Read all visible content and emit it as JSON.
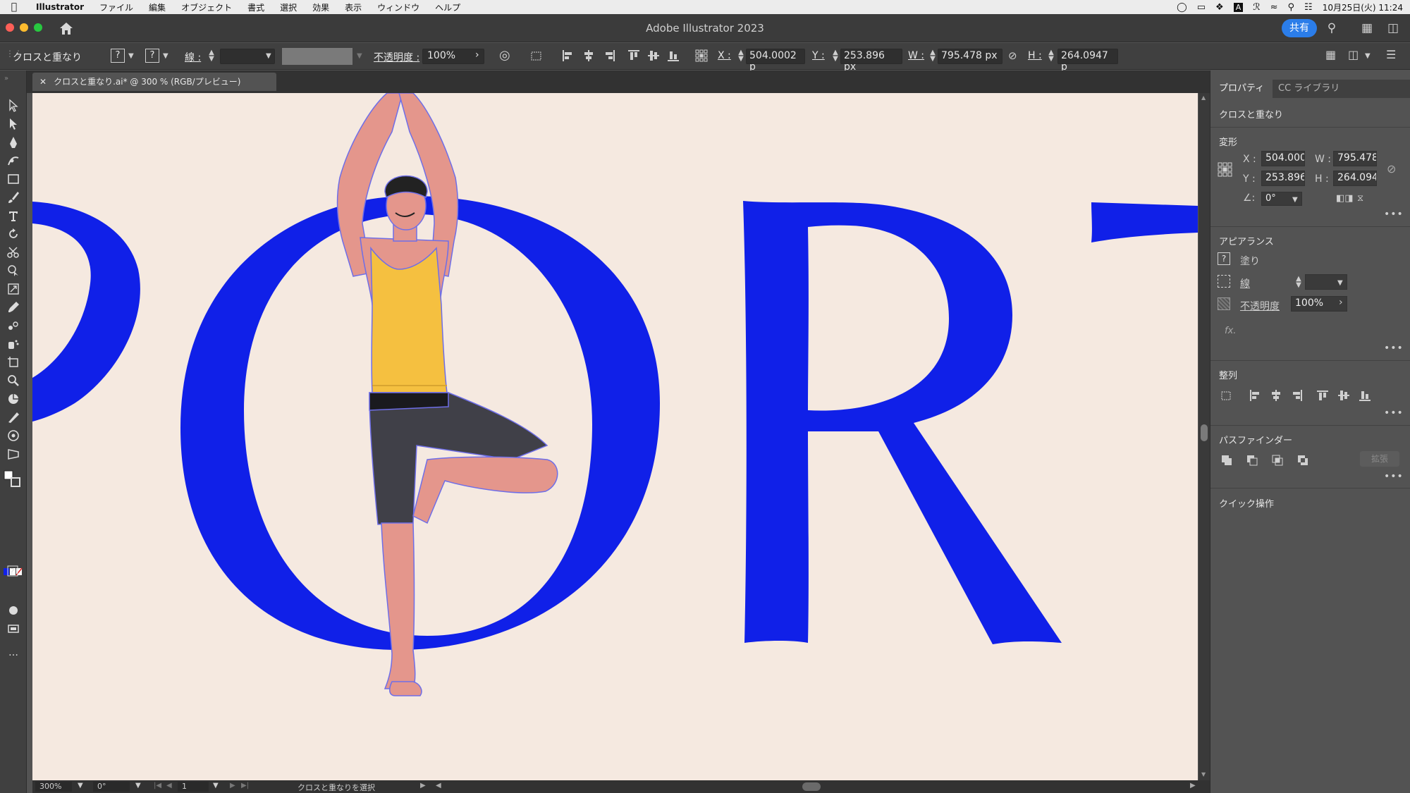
{
  "menubar": {
    "app": "Illustrator",
    "items": [
      "ファイル",
      "編集",
      "オブジェクト",
      "書式",
      "選択",
      "効果",
      "表示",
      "ウィンドウ",
      "ヘルプ"
    ],
    "datetime": "10月25日(火)  11:24"
  },
  "window": {
    "title": "Adobe Illustrator 2023",
    "share_label": "共有"
  },
  "controlbar": {
    "selection_name": "クロスと重なり",
    "stroke_label": "線 :",
    "opacity_label": "不透明度 :",
    "opacity_value": "100%",
    "x_label": "X :",
    "x_value": "504.0002 p",
    "y_label": "Y :",
    "y_value": "253.896 px",
    "w_label": "W :",
    "w_value": "795.478 px",
    "h_label": "H :",
    "h_value": "264.0947 p"
  },
  "document": {
    "tab_title": "クロスと重なり.ai* @ 300 % (RGB/プレビュー)"
  },
  "statusbar": {
    "zoom": "300%",
    "rotation": "0°",
    "artboard": "1",
    "status_text": "クロスと重なりを選択"
  },
  "panel": {
    "tabs": [
      "プロパティ",
      "CC ライブラリ"
    ],
    "selection_name": "クロスと重なり",
    "transform": {
      "title": "変形",
      "x_label": "X :",
      "x_value": "504.000",
      "y_label": "Y :",
      "y_value": "253.896",
      "w_label": "W :",
      "w_value": "795.478",
      "h_label": "H :",
      "h_value": "264.094",
      "angle_value": "0°"
    },
    "appearance": {
      "title": "アピアランス",
      "fill_label": "塗り",
      "stroke_label": "線",
      "opacity_label": "不透明度",
      "opacity_value": "100%",
      "fx_label": "fx."
    },
    "align": {
      "title": "整列"
    },
    "pathfinder": {
      "title": "パスファインダー",
      "expand_label": "拡張"
    },
    "quick_actions": {
      "title": "クイック操作"
    }
  },
  "artwork": {
    "letters": [
      "P",
      "O",
      "R",
      "T"
    ],
    "letter_color": "#1020e8",
    "background": "#f5e9e0"
  }
}
